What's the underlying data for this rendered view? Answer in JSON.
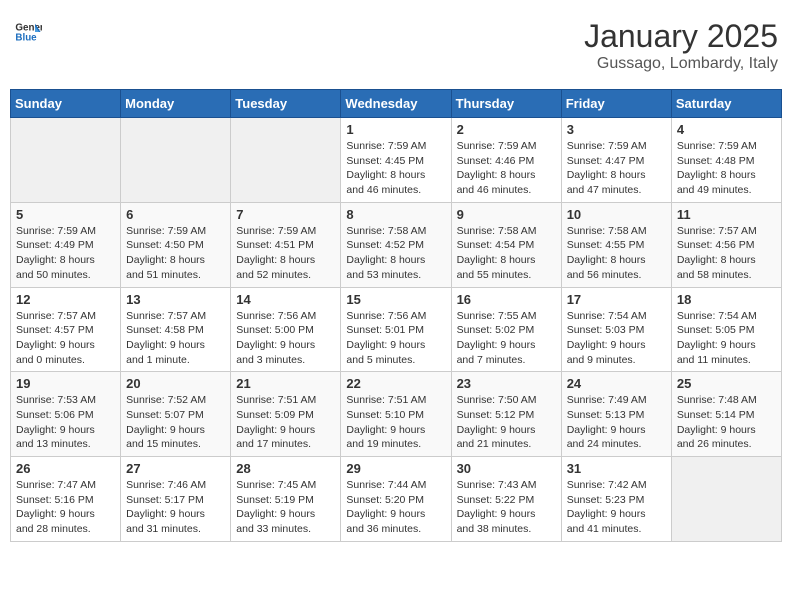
{
  "header": {
    "logo_general": "General",
    "logo_blue": "Blue",
    "month_title": "January 2025",
    "subtitle": "Gussago, Lombardy, Italy"
  },
  "weekdays": [
    "Sunday",
    "Monday",
    "Tuesday",
    "Wednesday",
    "Thursday",
    "Friday",
    "Saturday"
  ],
  "weeks": [
    [
      {
        "day": "",
        "info": ""
      },
      {
        "day": "",
        "info": ""
      },
      {
        "day": "",
        "info": ""
      },
      {
        "day": "1",
        "info": "Sunrise: 7:59 AM\nSunset: 4:45 PM\nDaylight: 8 hours\nand 46 minutes."
      },
      {
        "day": "2",
        "info": "Sunrise: 7:59 AM\nSunset: 4:46 PM\nDaylight: 8 hours\nand 46 minutes."
      },
      {
        "day": "3",
        "info": "Sunrise: 7:59 AM\nSunset: 4:47 PM\nDaylight: 8 hours\nand 47 minutes."
      },
      {
        "day": "4",
        "info": "Sunrise: 7:59 AM\nSunset: 4:48 PM\nDaylight: 8 hours\nand 49 minutes."
      }
    ],
    [
      {
        "day": "5",
        "info": "Sunrise: 7:59 AM\nSunset: 4:49 PM\nDaylight: 8 hours\nand 50 minutes."
      },
      {
        "day": "6",
        "info": "Sunrise: 7:59 AM\nSunset: 4:50 PM\nDaylight: 8 hours\nand 51 minutes."
      },
      {
        "day": "7",
        "info": "Sunrise: 7:59 AM\nSunset: 4:51 PM\nDaylight: 8 hours\nand 52 minutes."
      },
      {
        "day": "8",
        "info": "Sunrise: 7:58 AM\nSunset: 4:52 PM\nDaylight: 8 hours\nand 53 minutes."
      },
      {
        "day": "9",
        "info": "Sunrise: 7:58 AM\nSunset: 4:54 PM\nDaylight: 8 hours\nand 55 minutes."
      },
      {
        "day": "10",
        "info": "Sunrise: 7:58 AM\nSunset: 4:55 PM\nDaylight: 8 hours\nand 56 minutes."
      },
      {
        "day": "11",
        "info": "Sunrise: 7:57 AM\nSunset: 4:56 PM\nDaylight: 8 hours\nand 58 minutes."
      }
    ],
    [
      {
        "day": "12",
        "info": "Sunrise: 7:57 AM\nSunset: 4:57 PM\nDaylight: 9 hours\nand 0 minutes."
      },
      {
        "day": "13",
        "info": "Sunrise: 7:57 AM\nSunset: 4:58 PM\nDaylight: 9 hours\nand 1 minute."
      },
      {
        "day": "14",
        "info": "Sunrise: 7:56 AM\nSunset: 5:00 PM\nDaylight: 9 hours\nand 3 minutes."
      },
      {
        "day": "15",
        "info": "Sunrise: 7:56 AM\nSunset: 5:01 PM\nDaylight: 9 hours\nand 5 minutes."
      },
      {
        "day": "16",
        "info": "Sunrise: 7:55 AM\nSunset: 5:02 PM\nDaylight: 9 hours\nand 7 minutes."
      },
      {
        "day": "17",
        "info": "Sunrise: 7:54 AM\nSunset: 5:03 PM\nDaylight: 9 hours\nand 9 minutes."
      },
      {
        "day": "18",
        "info": "Sunrise: 7:54 AM\nSunset: 5:05 PM\nDaylight: 9 hours\nand 11 minutes."
      }
    ],
    [
      {
        "day": "19",
        "info": "Sunrise: 7:53 AM\nSunset: 5:06 PM\nDaylight: 9 hours\nand 13 minutes."
      },
      {
        "day": "20",
        "info": "Sunrise: 7:52 AM\nSunset: 5:07 PM\nDaylight: 9 hours\nand 15 minutes."
      },
      {
        "day": "21",
        "info": "Sunrise: 7:51 AM\nSunset: 5:09 PM\nDaylight: 9 hours\nand 17 minutes."
      },
      {
        "day": "22",
        "info": "Sunrise: 7:51 AM\nSunset: 5:10 PM\nDaylight: 9 hours\nand 19 minutes."
      },
      {
        "day": "23",
        "info": "Sunrise: 7:50 AM\nSunset: 5:12 PM\nDaylight: 9 hours\nand 21 minutes."
      },
      {
        "day": "24",
        "info": "Sunrise: 7:49 AM\nSunset: 5:13 PM\nDaylight: 9 hours\nand 24 minutes."
      },
      {
        "day": "25",
        "info": "Sunrise: 7:48 AM\nSunset: 5:14 PM\nDaylight: 9 hours\nand 26 minutes."
      }
    ],
    [
      {
        "day": "26",
        "info": "Sunrise: 7:47 AM\nSunset: 5:16 PM\nDaylight: 9 hours\nand 28 minutes."
      },
      {
        "day": "27",
        "info": "Sunrise: 7:46 AM\nSunset: 5:17 PM\nDaylight: 9 hours\nand 31 minutes."
      },
      {
        "day": "28",
        "info": "Sunrise: 7:45 AM\nSunset: 5:19 PM\nDaylight: 9 hours\nand 33 minutes."
      },
      {
        "day": "29",
        "info": "Sunrise: 7:44 AM\nSunset: 5:20 PM\nDaylight: 9 hours\nand 36 minutes."
      },
      {
        "day": "30",
        "info": "Sunrise: 7:43 AM\nSunset: 5:22 PM\nDaylight: 9 hours\nand 38 minutes."
      },
      {
        "day": "31",
        "info": "Sunrise: 7:42 AM\nSunset: 5:23 PM\nDaylight: 9 hours\nand 41 minutes."
      },
      {
        "day": "",
        "info": ""
      }
    ]
  ]
}
